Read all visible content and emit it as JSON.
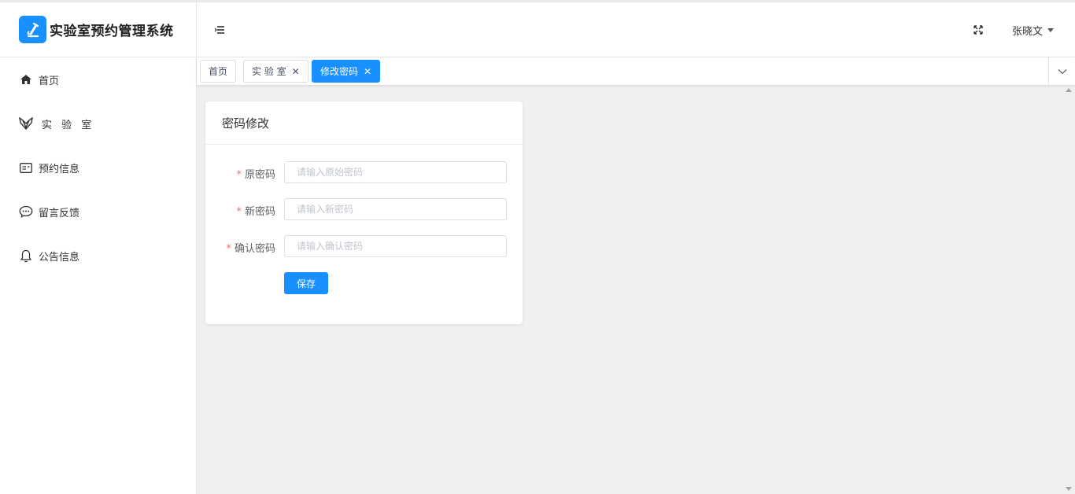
{
  "app": {
    "title": "实验室预约管理系统"
  },
  "sidebar": {
    "items": [
      {
        "label": "首页",
        "icon": "home-icon"
      },
      {
        "label": "实 验 室",
        "icon": "lab-icon"
      },
      {
        "label": "预约信息",
        "icon": "id-card-icon"
      },
      {
        "label": "留言反馈",
        "icon": "chat-icon"
      },
      {
        "label": "公告信息",
        "icon": "bell-icon"
      }
    ]
  },
  "header": {
    "user_name": "张晓文"
  },
  "tabs": [
    {
      "label": "首页",
      "closable": false,
      "active": false
    },
    {
      "label": "实 验 室",
      "closable": true,
      "active": false
    },
    {
      "label": "修改密码",
      "closable": true,
      "active": true
    }
  ],
  "card": {
    "title": "密码修改",
    "fields": [
      {
        "label": "原密码",
        "placeholder": "请输入原始密码",
        "value": ""
      },
      {
        "label": "新密码",
        "placeholder": "请输入新密码",
        "value": ""
      },
      {
        "label": "确认密码",
        "placeholder": "请输入确认密码",
        "value": ""
      }
    ],
    "save_label": "保存"
  },
  "colors": {
    "accent": "#1890ff",
    "required": "#f56c6c",
    "content_bg": "#f0f0f0"
  }
}
